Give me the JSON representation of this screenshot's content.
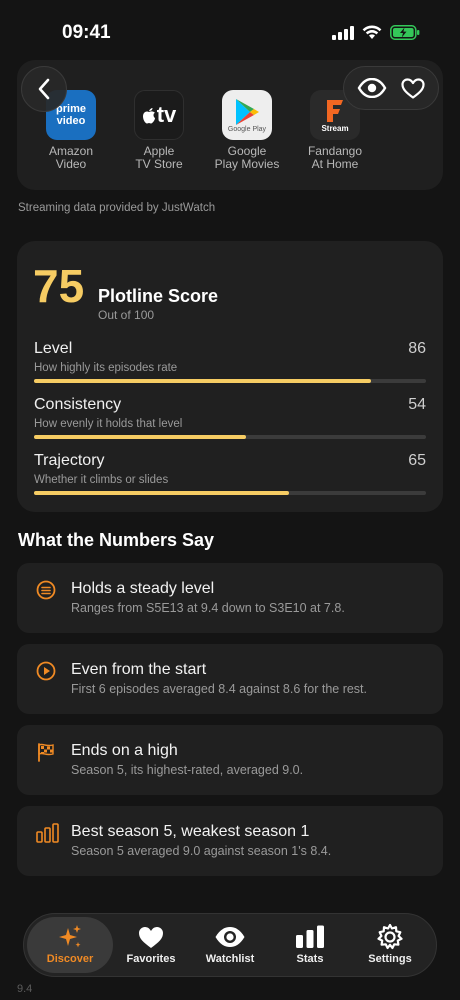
{
  "status": {
    "time": "09:41"
  },
  "providers": [
    {
      "name_line1": "Amazon",
      "name_line2": "Video",
      "logo_text": "prime video",
      "logo_bg": "#1a6fc0"
    },
    {
      "name_line1": "Apple",
      "name_line2": "TV Store",
      "logo_text": "tv",
      "logo_bg": "#1b1b1b"
    },
    {
      "name_line1": "Google",
      "name_line2": "Play Movies",
      "logo_text": "Google Play",
      "logo_bg": "#eeeeee"
    },
    {
      "name_line1": "Fandango",
      "name_line2": "At Home",
      "logo_text": "Stream",
      "logo_bg": "#2a2a2a"
    }
  ],
  "credit": "Streaming data provided by JustWatch",
  "score": {
    "value": "75",
    "title": "Plotline Score",
    "subtitle": "Out of 100",
    "accent": "#f6cc63",
    "metrics": [
      {
        "name": "Level",
        "value": "86",
        "fraction": 0.86,
        "desc": "How highly its episodes rate"
      },
      {
        "name": "Consistency",
        "value": "54",
        "fraction": 0.54,
        "desc": "How evenly it holds that level"
      },
      {
        "name": "Trajectory",
        "value": "65",
        "fraction": 0.65,
        "desc": "Whether it climbs or slides"
      }
    ]
  },
  "numbers_section": {
    "title": "What the Numbers Say",
    "icon_color": "#f08a24",
    "items": [
      {
        "icon": "steady-level-icon",
        "title": "Holds a steady level",
        "desc": "Ranges from S5E13 at 9.4 down to S3E10 at 7.8."
      },
      {
        "icon": "play-circle-icon",
        "title": "Even from the start",
        "desc": "First 6 episodes averaged 8.4 against 8.6 for the rest."
      },
      {
        "icon": "checkered-flag-icon",
        "title": "Ends on a high",
        "desc": "Season 5, its highest-rated, averaged 9.0."
      },
      {
        "icon": "bar-chart-icon",
        "title": "Best season 5, weakest season 1",
        "desc": "Season 5 averaged 9.0 against season 1's 8.4."
      }
    ]
  },
  "below": {
    "ghost_value": "9.4"
  },
  "tabs": [
    {
      "label": "Discover",
      "icon": "sparkles-icon",
      "active": true
    },
    {
      "label": "Favorites",
      "icon": "heart-icon",
      "active": false
    },
    {
      "label": "Watchlist",
      "icon": "eye-icon",
      "active": false
    },
    {
      "label": "Stats",
      "icon": "stats-icon",
      "active": false
    },
    {
      "label": "Settings",
      "icon": "gear-icon",
      "active": false
    }
  ],
  "tab_accent": "#f08a24"
}
